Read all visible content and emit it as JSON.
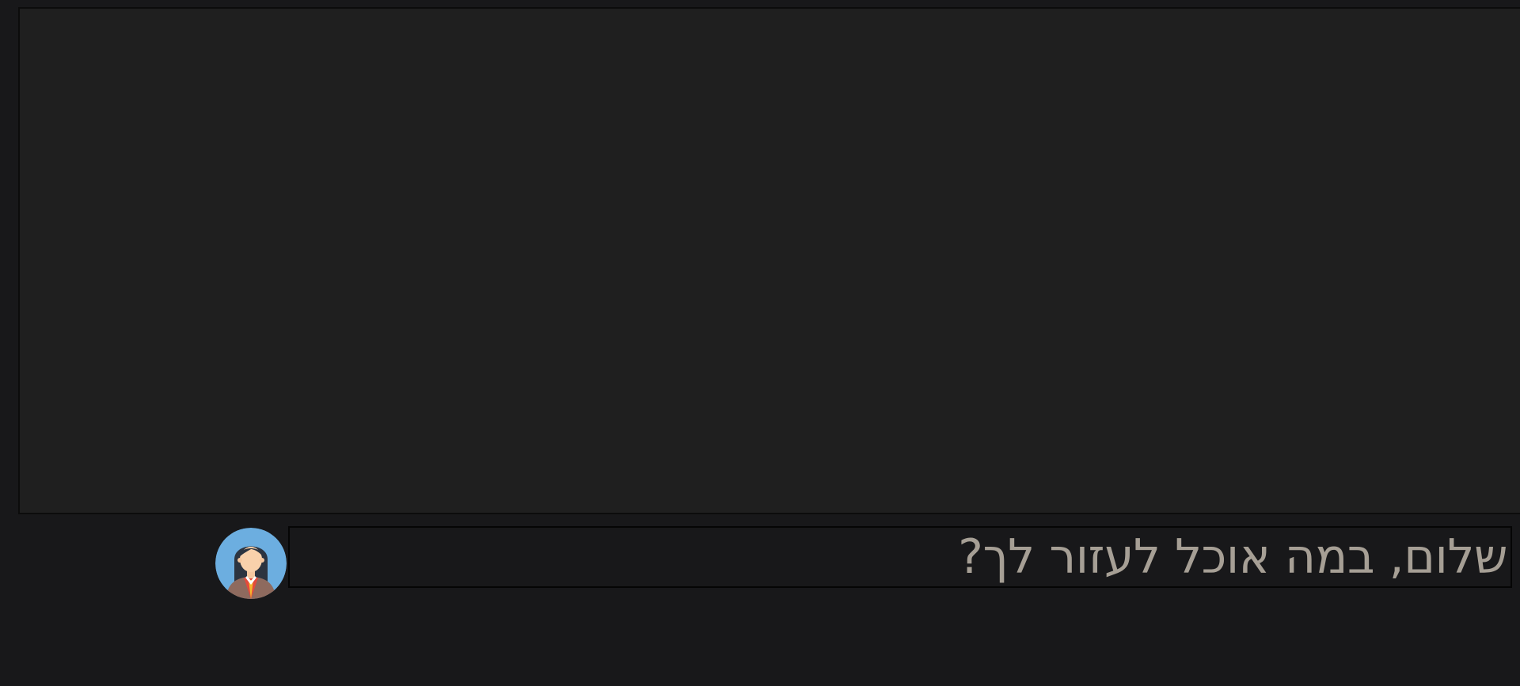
{
  "chat": {
    "messages": [
      {
        "sender": "assistant",
        "avatar_icon": "woman-agent-avatar-icon",
        "text": "שלום, במה אוכל לעזור לך?"
      }
    ]
  },
  "colors": {
    "page_background": "#18181a",
    "chat_area_background": "#1f1f1f",
    "bubble_background": "#18181a",
    "text": "#a69f95",
    "avatar_background": "#6caee0"
  }
}
